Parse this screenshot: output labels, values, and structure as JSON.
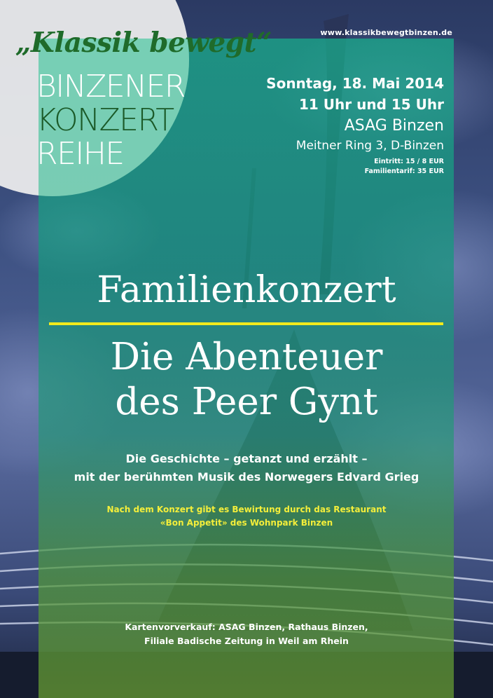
{
  "header": {
    "website": "www.klassikbewegtbinzen.de",
    "tagline": "„Klassik bewegt“",
    "series": [
      "BINZENER",
      "KONZERT",
      "REIHE"
    ]
  },
  "event": {
    "date": "Sonntag, 18. Mai 2014",
    "times": "11 Uhr und 15 Uhr",
    "venue": "ASAG Binzen",
    "address": "Meitner Ring 3, D-Binzen",
    "admission": "Eintritt: 15 / 8 EUR",
    "family_rate": "Familientarif: 35 EUR"
  },
  "title": {
    "kind": "Familienkonzert",
    "line1": "Die Abenteuer",
    "line2": "des Peer Gynt"
  },
  "subtitle": {
    "line1": "Die Geschichte – getanzt und erzählt –",
    "line2": "mit der berühmten Musik des Norwegers Edvard Grieg"
  },
  "note": {
    "line1": "Nach dem Konzert gibt es Bewirtung durch das Restaurant",
    "line2": "«Bon Appetit» des Wohnpark Binzen"
  },
  "presale": {
    "line1": "Kartenvorverkauf: ASAG Binzen, Rathaus Binzen,",
    "line2": "Filiale Badische Zeitung in Weil am Rhein"
  },
  "colors": {
    "panel": "#1aa88a",
    "accent_rule": "#f2ea1c",
    "note_text": "#f4ee3a",
    "tagline": "#1f6b2a"
  }
}
